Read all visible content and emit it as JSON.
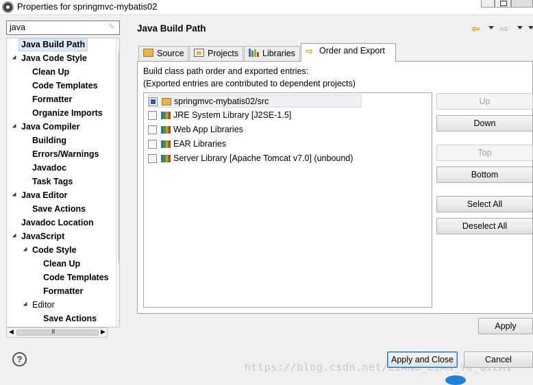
{
  "window": {
    "title": "Properties for springmvc-mybatis02"
  },
  "filter": {
    "value": "java"
  },
  "tree": {
    "items": [
      {
        "label": "Java Build Path",
        "selected": true
      },
      {
        "label": "Java Code Style",
        "expanded": true
      },
      {
        "label": "Clean Up"
      },
      {
        "label": "Code Templates"
      },
      {
        "label": "Formatter"
      },
      {
        "label": "Organize Imports"
      },
      {
        "label": "Java Compiler",
        "expanded": true
      },
      {
        "label": "Building"
      },
      {
        "label": "Errors/Warnings"
      },
      {
        "label": "Javadoc"
      },
      {
        "label": "Task Tags"
      },
      {
        "label": "Java Editor",
        "expanded": true
      },
      {
        "label": "Save Actions"
      },
      {
        "label": "Javadoc Location"
      },
      {
        "label": "JavaScript",
        "expanded": true
      },
      {
        "label": "Code Style",
        "expanded": true
      },
      {
        "label": "Clean Up"
      },
      {
        "label": "Code Templates"
      },
      {
        "label": "Formatter"
      },
      {
        "label": "Editor",
        "expanded": true
      },
      {
        "label": "Save Actions"
      }
    ],
    "hscroll_grip": "III"
  },
  "page": {
    "title": "Java Build Path"
  },
  "tabs": [
    {
      "label": "Source",
      "icon": "source-folder-icon"
    },
    {
      "label": "Projects",
      "icon": "projects-icon"
    },
    {
      "label": "Libraries",
      "icon": "libraries-icon"
    },
    {
      "label": "Order and Export",
      "icon": "order-export-icon",
      "active": true
    }
  ],
  "order_export": {
    "description_line1": "Build class path order and exported entries:",
    "description_line2": "(Exported entries are contributed to dependent projects)",
    "entries": [
      {
        "label": "springmvc-mybatis02/src",
        "checked": true,
        "icon": "source-folder-icon"
      },
      {
        "label": "JRE System Library [J2SE-1.5]",
        "checked": false,
        "icon": "library-icon"
      },
      {
        "label": "Web App Libraries",
        "checked": false,
        "icon": "library-icon"
      },
      {
        "label": "EAR Libraries",
        "checked": false,
        "icon": "library-icon"
      },
      {
        "label": "Server Library [Apache Tomcat v7.0] (unbound)",
        "checked": false,
        "icon": "library-icon"
      }
    ],
    "buttons": {
      "up": "Up",
      "down": "Down",
      "top": "Top",
      "bottom": "Bottom",
      "select_all": "Select All",
      "deselect_all": "Deselect All"
    }
  },
  "footer": {
    "apply": "Apply",
    "apply_close": "Apply and Close",
    "cancel": "Cancel",
    "help": "?"
  },
  "watermark": "https://blog.csdn.net/LIANG_LIAN_YU_QIZHI",
  "colors": {
    "selection": "#dde8f7",
    "checked": "#2d5a9e",
    "default_button_border": "#2f6fc6"
  }
}
